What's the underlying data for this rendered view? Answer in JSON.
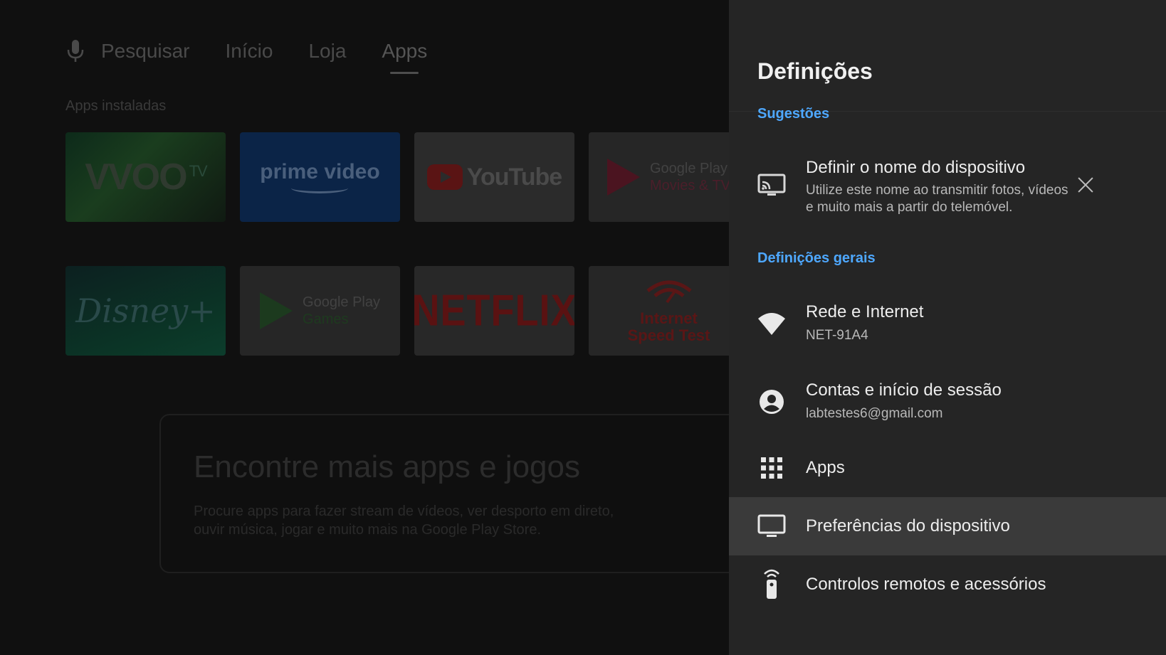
{
  "launcher": {
    "nav": {
      "search": "Pesquisar",
      "home": "Início",
      "store": "Loja",
      "apps": "Apps"
    },
    "installed_label": "Apps instaladas",
    "apps": {
      "voo": "VVOO",
      "voo_tv": "TV",
      "prime_line1": "prime video",
      "youtube": "YouTube",
      "gp_movies_line1": "Google Play",
      "gp_movies_line2": "Movies & TV",
      "disney": "Disney+",
      "gp_games_line1": "Google Play",
      "gp_games_line2": "Games",
      "netflix": "NETFLIX",
      "speed_line1": "Internet",
      "speed_line2": "Speed Test"
    },
    "promo": {
      "title": "Encontre mais apps e jogos",
      "desc": "Procure apps para fazer stream de vídeos, ver desporto em direto, ouvir música, jogar e muito mais na Google Play Store."
    }
  },
  "settings": {
    "title": "Definições",
    "suggestions_header": "Sugestões",
    "suggestion": {
      "title": "Definir o nome do dispositivo",
      "desc": "Utilize este nome ao transmitir fotos, vídeos e muito mais a partir do telemóvel."
    },
    "general_header": "Definições gerais",
    "items": [
      {
        "title": "Rede e Internet",
        "sub": "NET-91A4",
        "icon": "wifi-icon"
      },
      {
        "title": "Contas e início de sessão",
        "sub": "labtestes6@gmail.com",
        "icon": "account-icon"
      },
      {
        "title": "Apps",
        "sub": "",
        "icon": "apps-grid-icon"
      },
      {
        "title": "Preferências do dispositivo",
        "sub": "",
        "icon": "monitor-icon"
      },
      {
        "title": "Controlos remotos e acessórios",
        "sub": "",
        "icon": "remote-icon"
      }
    ],
    "colors": {
      "panel_bg": "#252525",
      "accent": "#4ea8ff",
      "highlight": "#3a3a3a"
    }
  }
}
